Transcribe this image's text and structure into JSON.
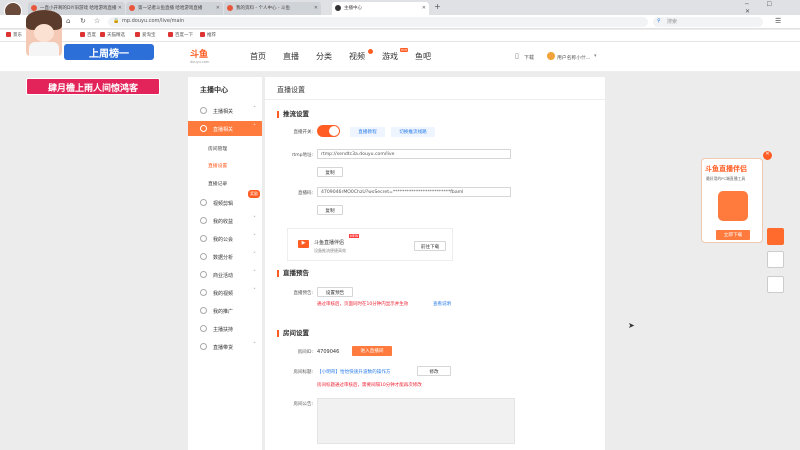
{
  "browser": {
    "tabs": [
      {
        "label": "一直小开啊的DIY旧游戏 哈哈游戏直播"
      },
      {
        "label": "第一记者斗鱼直播 哈哈游戏直播"
      },
      {
        "label": "我的资料 - 个人中心 - 斗鱼"
      },
      {
        "label": "主播中心"
      }
    ],
    "url": "mp.douyu.com/live/main",
    "search_placeholder": "搜索",
    "bookmarks": [
      "景东",
      "百度",
      "天猫精选",
      "百度一下",
      "爱淘宝",
      "百度一下",
      "推荐"
    ]
  },
  "site": {
    "logo_text": "斗鱼",
    "logo_sub": "douyu.com",
    "nav": [
      "首页",
      "直播",
      "分类",
      "视频",
      "游戏",
      "鱼吧"
    ],
    "game_tag": "HOT",
    "download": "下载",
    "user": "用户名称小什..."
  },
  "sidebar": {
    "title": "主播中心",
    "items": [
      {
        "label": "主播相关"
      },
      {
        "label": "直播相关"
      },
      {
        "label": "视频剪辑"
      },
      {
        "label": "我的收益"
      },
      {
        "label": "我的公会"
      },
      {
        "label": "数据分析"
      },
      {
        "label": "商业活动"
      },
      {
        "label": "我的视频"
      },
      {
        "label": "我的推广"
      },
      {
        "label": "主播扶持"
      },
      {
        "label": "直播带货"
      }
    ],
    "subitems": [
      "房间管理",
      "直播设置",
      "直播记录"
    ],
    "hot_tag": "奖励"
  },
  "content": {
    "page_title": "直播设置",
    "s1": {
      "title": "推流设置",
      "switch_label": "直播开关:",
      "btn_open": "直播教程",
      "btn_switch": "切换推流线路",
      "rtmp_label": "rtmp地址:",
      "rtmp_value": "rtmp://sendtc3a.douyu.com/live",
      "copy1": "复制",
      "code_label": "直播码:",
      "code_value": "4709046rMO0ChzU?wsSecret=*************************fbaml",
      "copy2": "复制",
      "promo_title": "斗鱼直播伴侣",
      "promo_new": "NEW",
      "promo_desc": "设备推流便捷高效",
      "promo_btn": "前往下载"
    },
    "s2": {
      "title": "直播预告",
      "label": "直播预告:",
      "btn": "设置预告",
      "warn": "通过审核后，页面同时在10分钟内显示并生效",
      "link": "查看说明"
    },
    "s3": {
      "title": "房间设置",
      "id_label": "房间ID:",
      "id_value": "4709046",
      "id_btn": "进入直播间",
      "title_label": "房间标题:",
      "title_value": "【小明哥】怡怡快速升波数的操作方",
      "edit": "修改",
      "warn": "房间标题通过审核后，需要间隔10分钟才能再次修改",
      "notice_label": "房间公告:"
    }
  },
  "overlay": {
    "banner": "上周榜一",
    "subtitle": "肆月檐上雨人间惊鸿客"
  },
  "widget": {
    "title": "斗鱼直播伴侣",
    "desc": "最好用的PC端直播工具",
    "btn": "立即下载"
  }
}
